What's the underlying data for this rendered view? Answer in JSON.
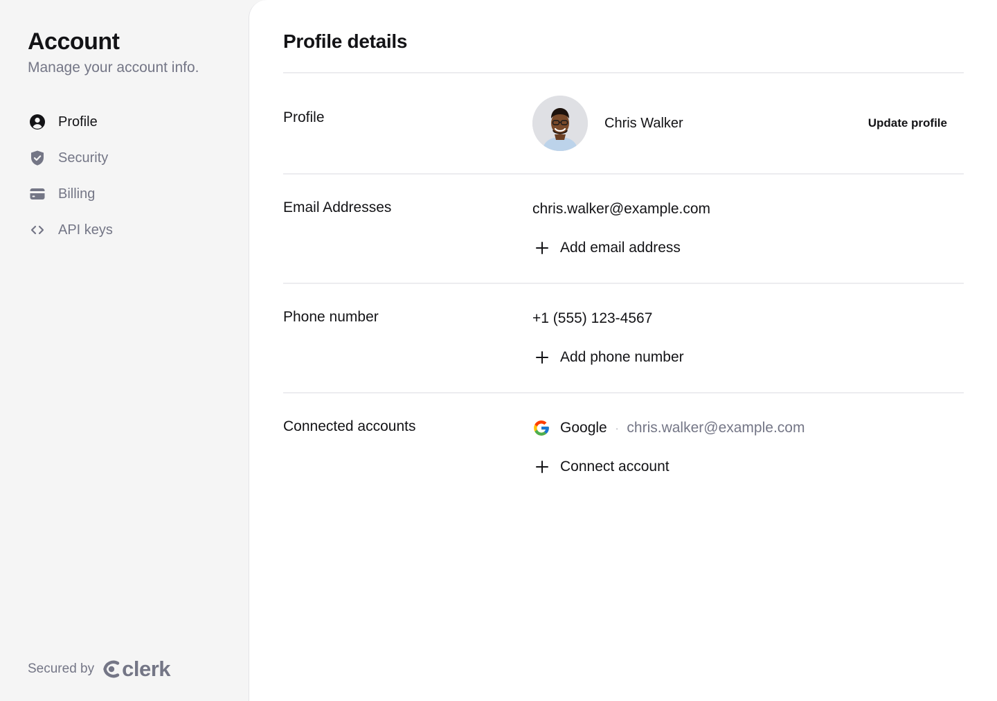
{
  "sidebar": {
    "title": "Account",
    "subtitle": "Manage your account info.",
    "items": [
      {
        "label": "Profile",
        "icon": "user-circle-icon",
        "active": true
      },
      {
        "label": "Security",
        "icon": "shield-check-icon",
        "active": false
      },
      {
        "label": "Billing",
        "icon": "credit-card-icon",
        "active": false
      },
      {
        "label": "API keys",
        "icon": "code-brackets-icon",
        "active": false
      }
    ],
    "secured_by": "Secured by",
    "brand": "clerk"
  },
  "main": {
    "title": "Profile details",
    "profile": {
      "label": "Profile",
      "name": "Chris Walker",
      "update_label": "Update profile"
    },
    "email": {
      "label": "Email Addresses",
      "value": "chris.walker@example.com",
      "add_label": "Add email address"
    },
    "phone": {
      "label": "Phone number",
      "value": "+1 (555) 123-4567",
      "add_label": "Add phone number"
    },
    "connected": {
      "label": "Connected accounts",
      "provider": "Google",
      "separator": "·",
      "email": "chris.walker@example.com",
      "add_label": "Connect account"
    }
  },
  "colors": {
    "sidebar_bg": "#f5f5f5",
    "panel_bg": "#ffffff",
    "text": "#131316",
    "muted": "#747686",
    "divider": "#ececef"
  }
}
